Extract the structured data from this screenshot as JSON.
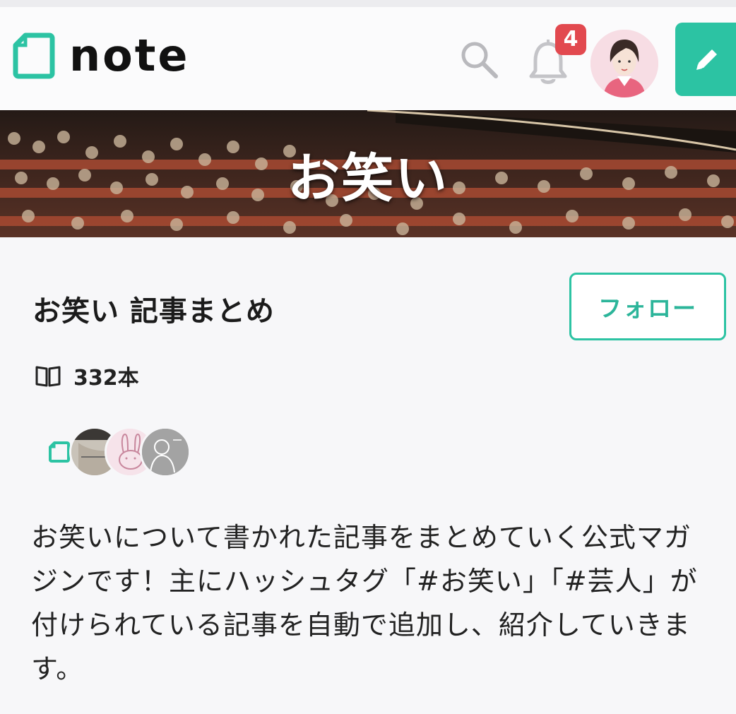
{
  "header": {
    "logo_text": "note",
    "notification_count": "4",
    "accent_color": "#2cc3a3",
    "badge_color": "#e2494f",
    "icons": [
      "note-logo-icon",
      "search-icon",
      "bell-icon",
      "pencil-icon"
    ]
  },
  "banner": {
    "title": "お笑い"
  },
  "magazine": {
    "title": "お笑い 記事まとめ",
    "follow_label": "フォロー",
    "article_count": "332本",
    "description": "お笑いについて書かれた記事をまとめていく公式マガジンです！主にハッシュタグ「#お笑い」「#芸人」が付けられている記事を自動で追加し、紹介していきます。",
    "writers": [
      "note-official-avatar",
      "writer-avatar-1",
      "writer-avatar-2",
      "writer-avatar-3"
    ]
  }
}
